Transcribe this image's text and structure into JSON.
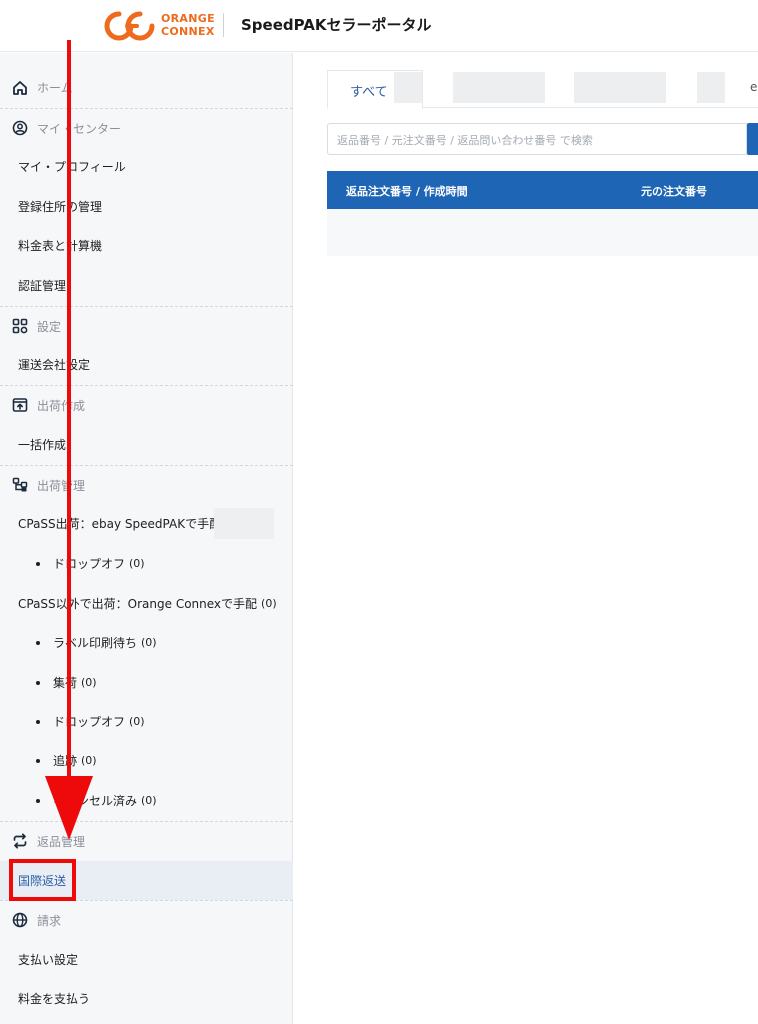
{
  "header": {
    "logo_line1": "ORANGE",
    "logo_line2": "CONNEX",
    "portal_title": "SpeedPAKセラーポータル"
  },
  "sidebar": {
    "home": "ホーム",
    "my_center": "マイ・センター",
    "my_profile": "マイ・プロフィール",
    "address_mgmt": "登録住所の管理",
    "rate_calc": "料金表と計算機",
    "auth_mgmt": "認証管理",
    "settings": "設定",
    "carrier_settings": "運送会社設定",
    "shipment_create": "出荷作成",
    "bulk_create": "一括作成",
    "shipment_mgmt": "出荷管理",
    "cpass_ebay": "CPaSS出荷：ebay SpeedPAKで手配",
    "cpass_ebay_sub": [
      {
        "label": "ドロップオフ",
        "count": "(0)"
      }
    ],
    "cpass_oc": "CPaSS以外で出荷：Orange Connexで手配",
    "cpass_oc_count": "(0)",
    "cpass_oc_sub": [
      {
        "label": "ラベル印刷待ち",
        "count": "(0)"
      },
      {
        "label": "集荷",
        "count": "(0)"
      },
      {
        "label": "ドロップオフ",
        "count": "(0)"
      },
      {
        "label": "追跡",
        "count": "(0)"
      },
      {
        "label": "キャンセル済み",
        "count": "(0)"
      }
    ],
    "returns_mgmt": "返品管理",
    "intl_returns": "国際返送",
    "billing": "請求",
    "payment_settings": "支払い設定",
    "pay_fees": "料金を支払う"
  },
  "main": {
    "tab_all": "すべて",
    "tab_cut": "e",
    "search_placeholder": "返品番号 / 元注文番号 / 返品問い合わせ番号 で検索",
    "columns": [
      "返品注文番号 / 作成時間",
      "元の注文番号"
    ]
  },
  "colors": {
    "brand_orange": "#ee6a1c",
    "primary_blue": "#1e66b5",
    "annotation_red": "#ee0a0a"
  }
}
